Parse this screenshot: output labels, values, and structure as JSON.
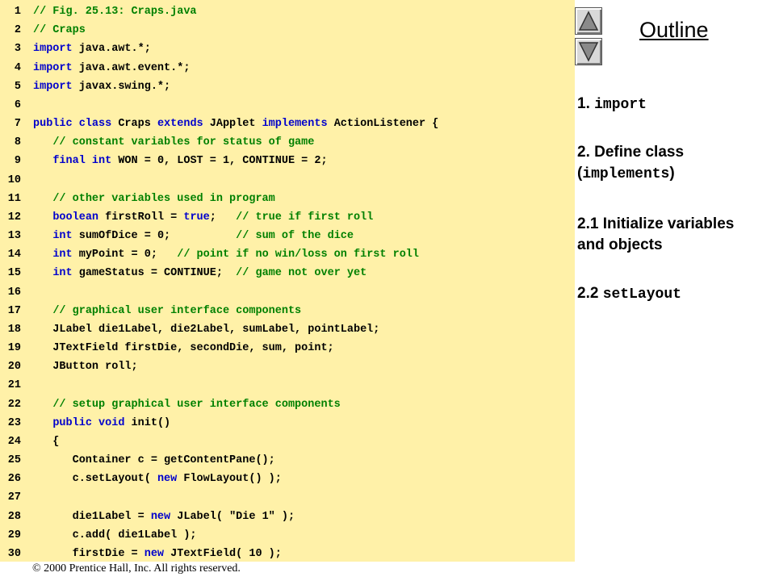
{
  "code_lines": [
    {
      "n": "1",
      "parts": [
        {
          "t": "// Fig. 25.13: Craps.java",
          "c": "cm"
        }
      ]
    },
    {
      "n": "2",
      "parts": [
        {
          "t": "// Craps",
          "c": "cm"
        }
      ]
    },
    {
      "n": "3",
      "parts": [
        {
          "t": "import",
          "c": "kw"
        },
        {
          "t": " java.awt.*;",
          "c": ""
        }
      ]
    },
    {
      "n": "4",
      "parts": [
        {
          "t": "import",
          "c": "kw"
        },
        {
          "t": " java.awt.event.*;",
          "c": ""
        }
      ]
    },
    {
      "n": "5",
      "parts": [
        {
          "t": "import",
          "c": "kw"
        },
        {
          "t": " javax.swing.*;",
          "c": ""
        }
      ]
    },
    {
      "n": "6",
      "parts": []
    },
    {
      "n": "7",
      "parts": [
        {
          "t": "public class",
          "c": "kw"
        },
        {
          "t": " Craps ",
          "c": ""
        },
        {
          "t": "extends",
          "c": "kw"
        },
        {
          "t": " JApplet ",
          "c": ""
        },
        {
          "t": "implements",
          "c": "kw"
        },
        {
          "t": " ActionListener {",
          "c": ""
        }
      ]
    },
    {
      "n": "8",
      "parts": [
        {
          "t": "   ",
          "c": ""
        },
        {
          "t": "// constant variables for status of game",
          "c": "cm"
        }
      ]
    },
    {
      "n": "9",
      "parts": [
        {
          "t": "   ",
          "c": ""
        },
        {
          "t": "final int",
          "c": "kw"
        },
        {
          "t": " WON = 0, LOST = 1, CONTINUE = 2;",
          "c": ""
        }
      ]
    },
    {
      "n": "10",
      "parts": []
    },
    {
      "n": "11",
      "parts": [
        {
          "t": "   ",
          "c": ""
        },
        {
          "t": "// other variables used in program",
          "c": "cm"
        }
      ]
    },
    {
      "n": "12",
      "parts": [
        {
          "t": "   ",
          "c": ""
        },
        {
          "t": "boolean",
          "c": "kw"
        },
        {
          "t": " firstRoll = ",
          "c": ""
        },
        {
          "t": "true",
          "c": "kw"
        },
        {
          "t": ";   ",
          "c": ""
        },
        {
          "t": "// true if first roll",
          "c": "cm"
        }
      ]
    },
    {
      "n": "13",
      "parts": [
        {
          "t": "   ",
          "c": ""
        },
        {
          "t": "int",
          "c": "kw"
        },
        {
          "t": " sumOfDice = 0;          ",
          "c": ""
        },
        {
          "t": "// sum of the dice",
          "c": "cm"
        }
      ]
    },
    {
      "n": "14",
      "parts": [
        {
          "t": "   ",
          "c": ""
        },
        {
          "t": "int",
          "c": "kw"
        },
        {
          "t": " myPoint = 0;   ",
          "c": ""
        },
        {
          "t": "// point if no win/loss on first roll",
          "c": "cm"
        }
      ]
    },
    {
      "n": "15",
      "parts": [
        {
          "t": "   ",
          "c": ""
        },
        {
          "t": "int",
          "c": "kw"
        },
        {
          "t": " gameStatus = CONTINUE;  ",
          "c": ""
        },
        {
          "t": "// game not over yet",
          "c": "cm"
        }
      ]
    },
    {
      "n": "16",
      "parts": []
    },
    {
      "n": "17",
      "parts": [
        {
          "t": "   ",
          "c": ""
        },
        {
          "t": "// graphical user interface components",
          "c": "cm"
        }
      ]
    },
    {
      "n": "18",
      "parts": [
        {
          "t": "   JLabel die1Label, die2Label, sumLabel, pointLabel;",
          "c": ""
        }
      ]
    },
    {
      "n": "19",
      "parts": [
        {
          "t": "   JTextField firstDie, secondDie, sum, point;",
          "c": ""
        }
      ]
    },
    {
      "n": "20",
      "parts": [
        {
          "t": "   JButton roll;",
          "c": ""
        }
      ]
    },
    {
      "n": "21",
      "parts": []
    },
    {
      "n": "22",
      "parts": [
        {
          "t": "   ",
          "c": ""
        },
        {
          "t": "// setup graphical user interface components",
          "c": "cm"
        }
      ]
    },
    {
      "n": "23",
      "parts": [
        {
          "t": "   ",
          "c": ""
        },
        {
          "t": "public void",
          "c": "kw"
        },
        {
          "t": " init()",
          "c": ""
        }
      ]
    },
    {
      "n": "24",
      "parts": [
        {
          "t": "   {",
          "c": ""
        }
      ]
    },
    {
      "n": "25",
      "parts": [
        {
          "t": "      Container c = getContentPane();",
          "c": ""
        }
      ]
    },
    {
      "n": "26",
      "parts": [
        {
          "t": "      c.setLayout( ",
          "c": ""
        },
        {
          "t": "new",
          "c": "kw"
        },
        {
          "t": " FlowLayout() );",
          "c": ""
        }
      ]
    },
    {
      "n": "27",
      "parts": []
    },
    {
      "n": "28",
      "parts": [
        {
          "t": "      die1Label = ",
          "c": ""
        },
        {
          "t": "new",
          "c": "kw"
        },
        {
          "t": " JLabel( ",
          "c": ""
        },
        {
          "t": "\"Die 1\"",
          "c": "str"
        },
        {
          "t": " );",
          "c": ""
        }
      ]
    },
    {
      "n": "29",
      "parts": [
        {
          "t": "      c.add( die1Label );",
          "c": ""
        }
      ]
    },
    {
      "n": "30",
      "parts": [
        {
          "t": "      firstDie = ",
          "c": ""
        },
        {
          "t": "new",
          "c": "kw"
        },
        {
          "t": " JTextField( 10 );",
          "c": ""
        }
      ]
    }
  ],
  "outline": {
    "title": "Outline",
    "items": [
      {
        "prefix": "1. ",
        "mono": "import",
        "suffix": ""
      },
      {
        "prefix": "2. Define class (",
        "mono": "implements",
        "suffix": ")"
      },
      {
        "prefix": "2.1 Initialize variables and objects",
        "mono": "",
        "suffix": ""
      },
      {
        "prefix": "2.2 ",
        "mono": "setLayout",
        "suffix": ""
      }
    ]
  },
  "nav": {
    "up_icon": "triangle-up-icon",
    "down_icon": "triangle-down-icon"
  },
  "footer": {
    "text": "© 2000 Prentice Hall, Inc.  All rights reserved."
  },
  "colors": {
    "panel_bg": "#fff1a8",
    "keyword": "#0000cc",
    "comment": "#008000"
  }
}
